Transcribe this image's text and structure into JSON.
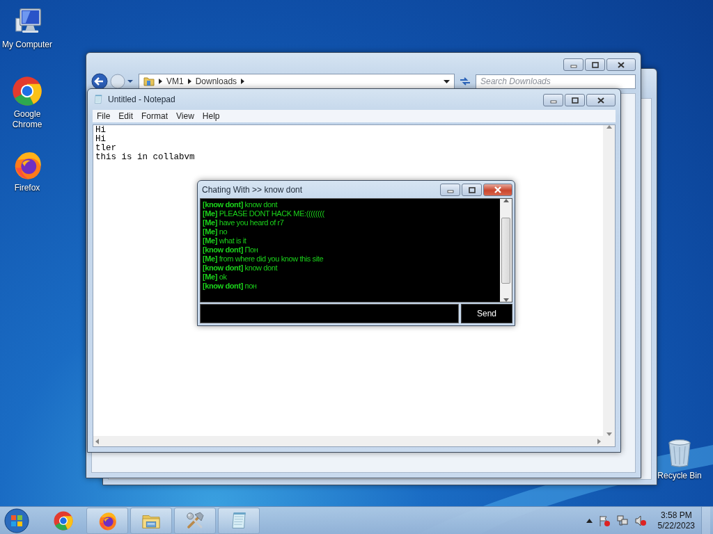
{
  "desktop_icons": [
    {
      "label": "My Computer",
      "kind": "computer"
    },
    {
      "label": "Google Chrome",
      "kind": "chrome"
    },
    {
      "label": "Firefox",
      "kind": "firefox"
    }
  ],
  "recycle_bin": {
    "label": "Recycle Bin",
    "kind": "bin"
  },
  "explorer": {
    "breadcrumb": [
      "VM1",
      "Downloads"
    ],
    "search": {
      "placeholder": "Search Downloads"
    }
  },
  "notepad": {
    "title": "Untitled - Notepad",
    "menu": [
      "File",
      "Edit",
      "Format",
      "View",
      "Help"
    ],
    "lines": [
      "Hi",
      "Hi",
      "tler",
      "this is in collabvm"
    ]
  },
  "chat": {
    "title": "Chating With >> know dont",
    "messages": [
      {
        "sender": "[know dont]",
        "text": "know dont"
      },
      {
        "sender": "[Me]",
        "text": "PLEASE DONT HACK ME:(((((((("
      },
      {
        "sender": "[Me]",
        "text": "have you heard of r7"
      },
      {
        "sender": "[Me]",
        "text": "no"
      },
      {
        "sender": "[Me]",
        "text": "what is it"
      },
      {
        "sender": "[know dont]",
        "text": "Пон"
      },
      {
        "sender": "[Me]",
        "text": "from where did you know this site"
      },
      {
        "sender": "[know dont]",
        "text": "know dont"
      },
      {
        "sender": "[Me]",
        "text": "ok"
      },
      {
        "sender": "[know dont]",
        "text": "пон"
      }
    ],
    "send": "Send"
  },
  "taskbar": {
    "apps": [
      {
        "kind": "chrome",
        "running": false
      },
      {
        "kind": "firefox",
        "running": true
      },
      {
        "kind": "folder",
        "running": true
      },
      {
        "kind": "tools",
        "running": true
      },
      {
        "kind": "notepad",
        "running": true
      }
    ],
    "clock": {
      "time": "3:58 PM",
      "date": "5/22/2023"
    }
  }
}
